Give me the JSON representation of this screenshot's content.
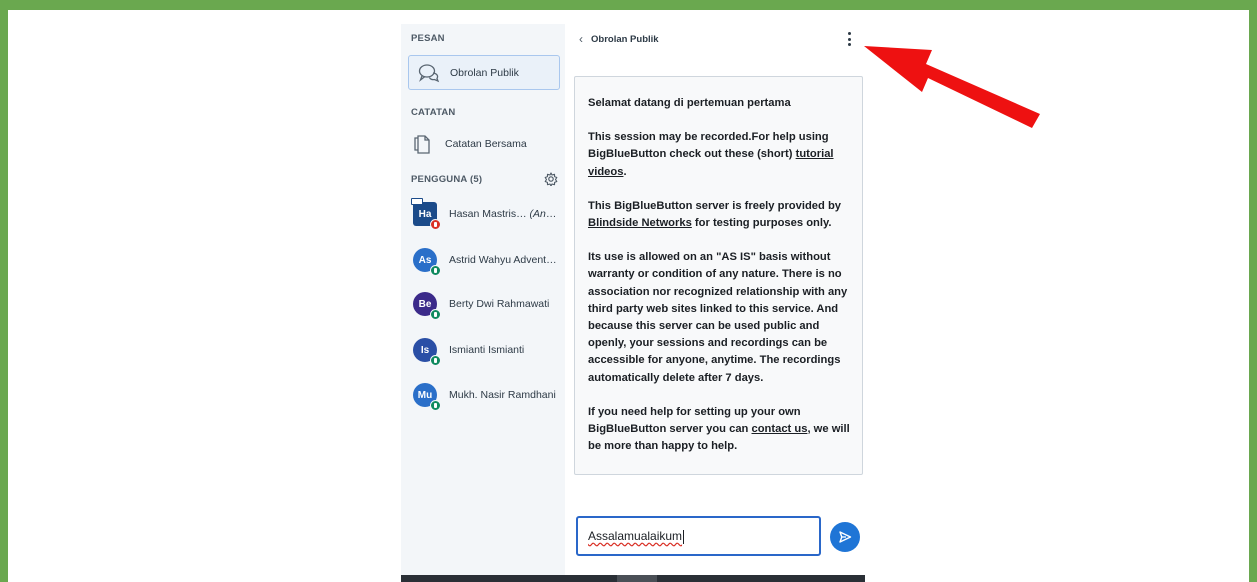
{
  "sidebar": {
    "messages_header": "PESAN",
    "public_chat_label": "Obrolan Publik",
    "notes_header": "CATATAN",
    "shared_notes_label": "Catatan Bersama",
    "users_header": "PENGGUNA (5)",
    "users": [
      {
        "initials": "Ha",
        "name": "Hasan Mastris…",
        "suffix": " (Anda)",
        "color": "#1b4b8a",
        "status": "muted",
        "status_color": "#d93025"
      },
      {
        "initials": "As",
        "name": "Astrid Wahyu Advent…",
        "suffix": "",
        "color": "#2a6fc9",
        "status": "listen-only",
        "status_color": "#0f8a5f"
      },
      {
        "initials": "Be",
        "name": "Berty Dwi Rahmawati",
        "suffix": "",
        "color": "#3b2a8a",
        "status": "listen-only",
        "status_color": "#0f8a5f"
      },
      {
        "initials": "Is",
        "name": "Ismianti Ismianti",
        "suffix": "",
        "color": "#2a4fa6",
        "status": "listen-only",
        "status_color": "#0f8a5f"
      },
      {
        "initials": "Mu",
        "name": "Mukh. Nasir Ramdhani",
        "suffix": "",
        "color": "#2a6fc9",
        "status": "listen-only",
        "status_color": "#0f8a5f"
      }
    ]
  },
  "chat": {
    "title": "Obrolan Publik",
    "welcome": {
      "heading": "Selamat datang di pertemuan pertama",
      "p1_text": "This session may be recorded.For help using BigBlueButton check out these (short) ",
      "p1_link": "tutorial videos",
      "p1_end": ".",
      "p2_text": "This BigBlueButton server is freely provided by ",
      "p2_link": "Blindside Networks",
      "p2_end": " for testing purposes only.",
      "p3": "Its use is allowed on an \"AS IS\" basis without warranty or condition of any nature. There is no association nor recognized relationship with any third party web sites linked to this service. And because this server can be used public and openly, your sessions and recordings can be accessible for anyone, anytime. The recordings automatically delete after 7 days.",
      "p4_text": "If you need help for setting up your own BigBlueButton server you can ",
      "p4_link": "contact us",
      "p4_end": ", we will be more than happy to help."
    },
    "input_value": "Assalamualaikum"
  },
  "colors": {
    "frame_border": "#6aa84f",
    "accent": "#1f75d6",
    "annotation_arrow": "#ee1111"
  }
}
